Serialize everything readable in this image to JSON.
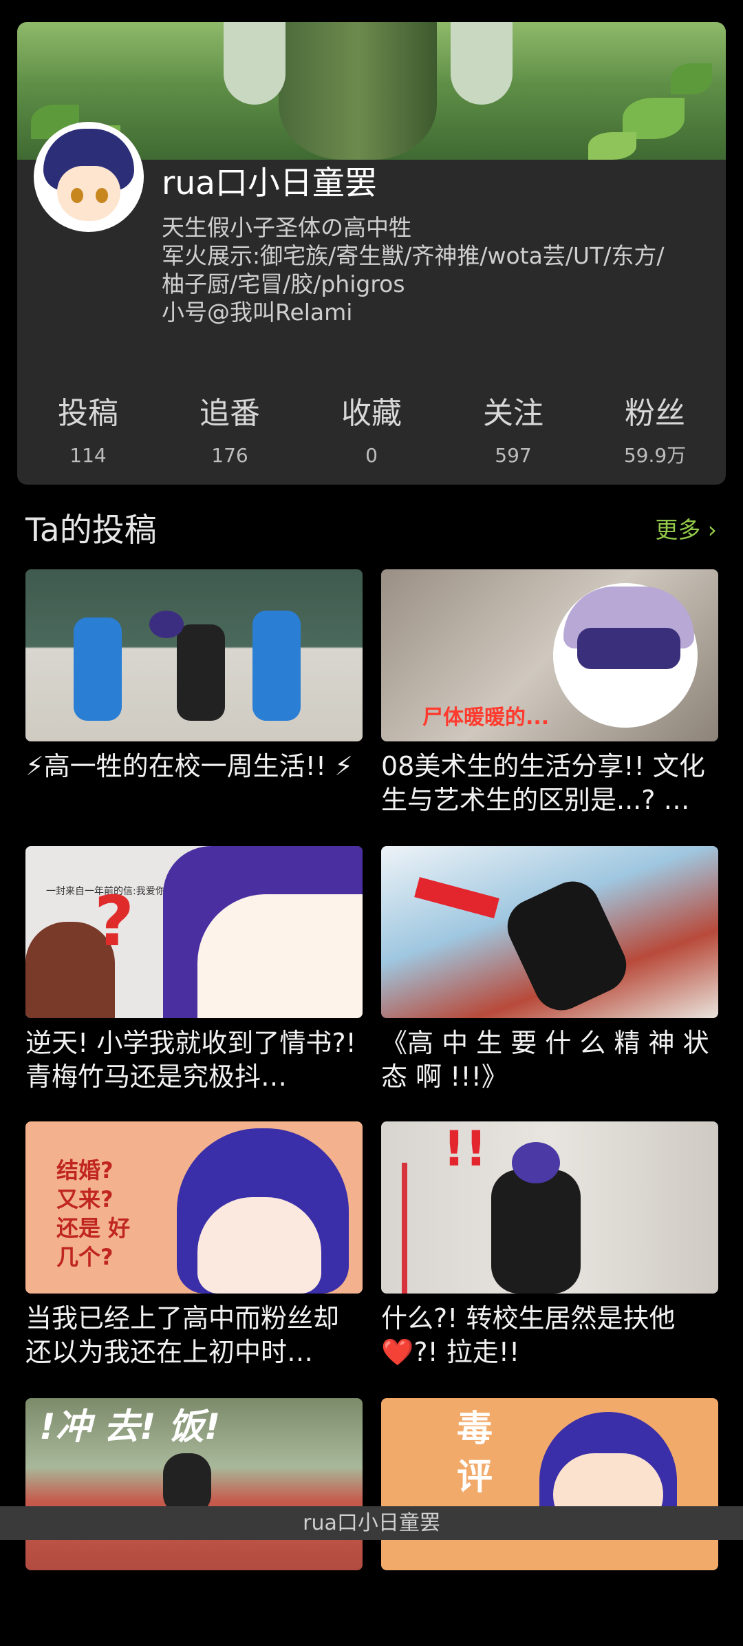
{
  "profile": {
    "username": "rua口小日童罢",
    "bio_lines": [
      "天生假小子圣体の高中牲",
      "军火展示:御宅族/寄生獣/齐神推/wota芸/UT/东方/",
      "柚子厨/宅冒/胶/phigros",
      "小号@我叫Relami"
    ]
  },
  "stats": [
    {
      "label": "投稿",
      "value": "114"
    },
    {
      "label": "追番",
      "value": "176"
    },
    {
      "label": "收藏",
      "value": "0"
    },
    {
      "label": "关注",
      "value": "597"
    },
    {
      "label": "粉丝",
      "value": "59.9万"
    }
  ],
  "section": {
    "title": "Ta的投稿",
    "more": "更多 ›"
  },
  "videos": [
    {
      "title": "⚡高一牲的在校一周生活!! ⚡"
    },
    {
      "title": "08美术生的生活分享!! 文化生与艺术生的区别是...? …",
      "caption": "尸体暖暖的..."
    },
    {
      "title": "逆天! 小学我就收到了情书?! 青梅竹马还是究极抖…",
      "caption": "一封来自一年前的信:我爱你"
    },
    {
      "title": "《高 中 生 要 什 么 精 神 状 态 啊 !!!》"
    },
    {
      "title": "当我已经上了高中而粉丝却还以为我还在上初中时…",
      "caption": "结婚? 又来? 还是 好几个?"
    },
    {
      "title": "什么?! 转校生居然是扶他❤️?! 拉走!!"
    },
    {
      "title": "",
      "caption": "!冲 去! 饭!"
    },
    {
      "title": "",
      "caption": "毒 评"
    }
  ],
  "bottom_bar": {
    "title": "rua口小日童罢"
  },
  "colors": {
    "accent": "#93c94a",
    "card_bg": "#2a2a2a",
    "page_bg": "#000000"
  }
}
